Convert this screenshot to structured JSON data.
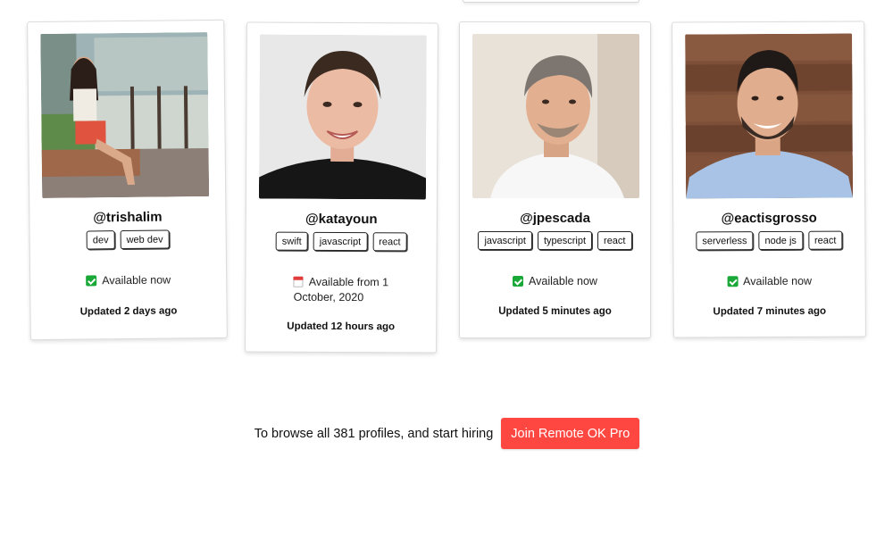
{
  "profiles": [
    {
      "handle": "@trishalim",
      "tags": [
        "dev",
        "web dev"
      ],
      "availability": "Available now",
      "availability_icon": "check-icon",
      "updated": "Updated 2 days ago",
      "photo": "photo-trishalim"
    },
    {
      "handle": "@katayoun",
      "tags": [
        "swift",
        "javascript",
        "react"
      ],
      "availability_line1": "Available from 1",
      "availability_line2": "October, 2020",
      "availability_icon": "calendar-icon",
      "updated": "Updated 12 hours ago",
      "photo": "photo-katayoun"
    },
    {
      "handle": "@jpescada",
      "tags": [
        "javascript",
        "typescript",
        "react"
      ],
      "availability": "Available now",
      "availability_icon": "check-icon",
      "updated": "Updated 5 minutes ago",
      "photo": "photo-jpescada"
    },
    {
      "handle": "@eactisgrosso",
      "tags": [
        "serverless",
        "node js",
        "react"
      ],
      "availability": "Available now",
      "availability_icon": "check-icon",
      "updated": "Updated 7 minutes ago",
      "photo": "photo-eactisgrosso"
    }
  ],
  "cta": {
    "text": "To browse all 381 profiles, and start hiring",
    "button_label": "Join Remote OK Pro"
  },
  "colors": {
    "accent": "#ff4742",
    "available_green": "#1aa839"
  }
}
